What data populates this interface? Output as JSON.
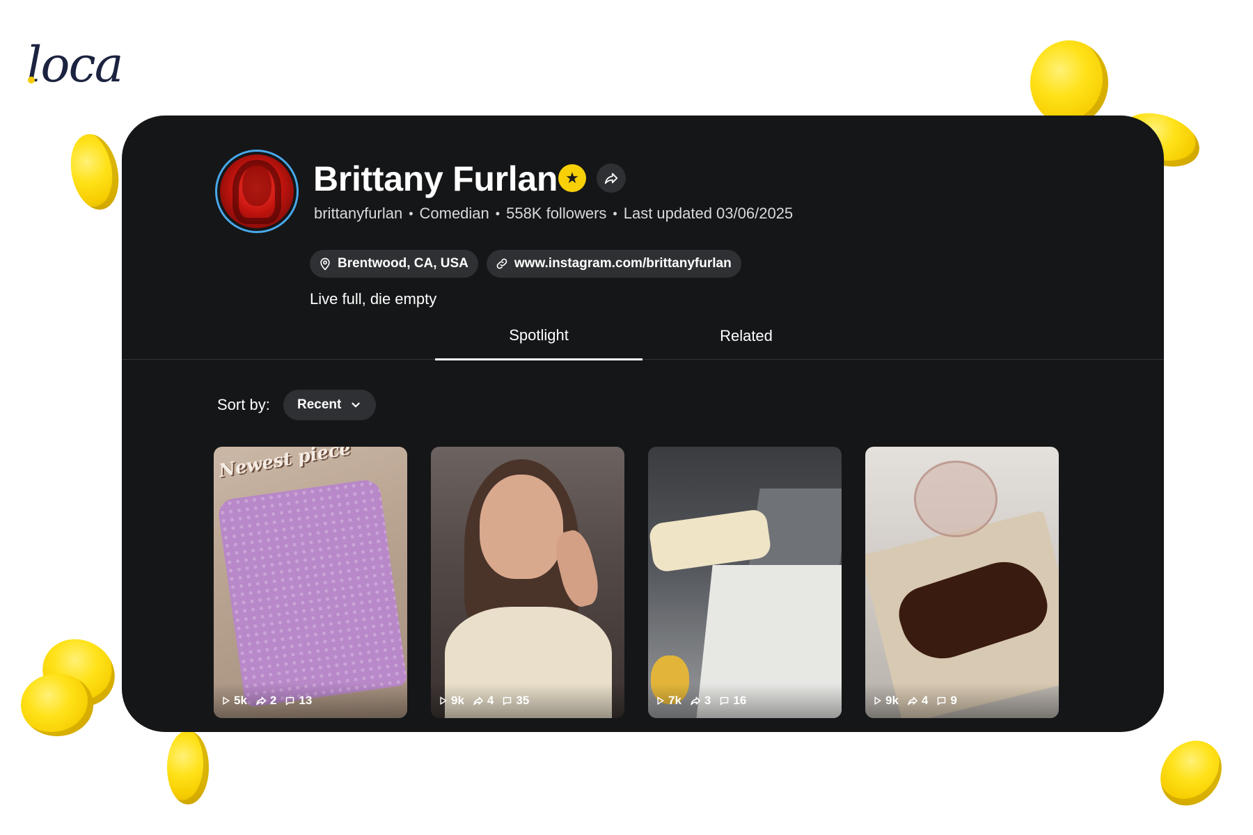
{
  "brand": {
    "logo_text": "loca"
  },
  "profile": {
    "name": "Brittany Furlan",
    "username": "brittanyfurlan",
    "category": "Comedian",
    "followers": "558K followers",
    "last_updated": "Last updated 03/06/2025",
    "location": "Brentwood, CA, USA",
    "website": "www.instagram.com/brittanyfurlan",
    "bio": "Live full, die empty"
  },
  "tabs": [
    {
      "label": "Spotlight",
      "active": true
    },
    {
      "label": "Related",
      "active": false
    }
  ],
  "sort": {
    "label": "Sort by:",
    "value": "Recent"
  },
  "videos": [
    {
      "views": "5k",
      "shares": "2",
      "comments": "13"
    },
    {
      "views": "9k",
      "shares": "4",
      "comments": "35"
    },
    {
      "views": "7k",
      "shares": "3",
      "comments": "16"
    },
    {
      "views": "9k",
      "shares": "4",
      "comments": "9"
    }
  ],
  "thumb_overlays": {
    "t1_caption": "Newest piece"
  },
  "colors": {
    "card_bg": "#151618",
    "accent_coin": "#f6cd00",
    "avatar_ring": "#4aa8ea",
    "chip_bg": "#2f3033"
  },
  "icons": [
    "location-pin-icon",
    "link-icon",
    "share-icon",
    "star-icon",
    "chevron-down-icon",
    "play-icon",
    "comment-icon"
  ]
}
